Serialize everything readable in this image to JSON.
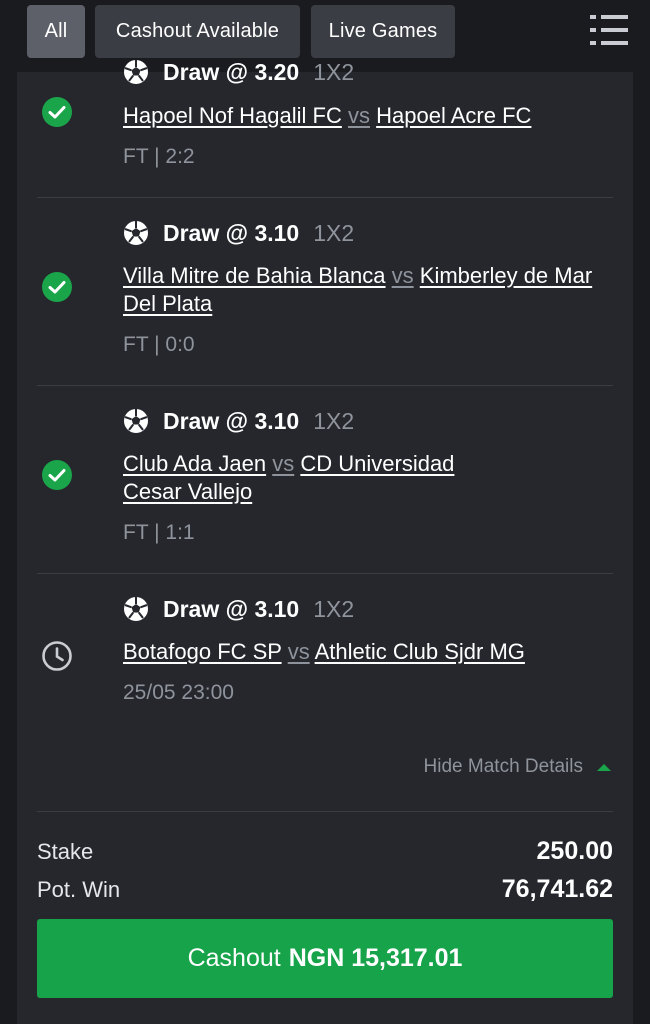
{
  "filters": [
    {
      "label": "All",
      "active": true
    },
    {
      "label": "Cashout Available",
      "active": false
    },
    {
      "label": "Live Games",
      "active": false
    }
  ],
  "legs": [
    {
      "pick": "Draw @ 3.20",
      "market": "1X2",
      "home": "Hapoel Nof Hagalil FC",
      "vs": "vs",
      "away": "Hapoel Acre FC",
      "meta": "FT | 2:2",
      "status": "won"
    },
    {
      "pick": "Draw @ 3.10",
      "market": "1X2",
      "home": "Villa Mitre de Bahia Blanca",
      "vs": "vs",
      "away": "Kimberley de Mar Del Plata",
      "meta": "FT | 0:0",
      "status": "won"
    },
    {
      "pick": "Draw @ 3.10",
      "market": "1X2",
      "home": "Club Ada Jaen",
      "vs": "vs",
      "away": "CD Universidad Cesar Vallejo",
      "meta": "FT | 1:1",
      "status": "won"
    },
    {
      "pick": "Draw @ 3.10",
      "market": "1X2",
      "home": "Botafogo FC SP",
      "vs": "vs",
      "away": "Athletic Club Sjdr MG",
      "meta": "25/05 23:00",
      "status": "pending"
    }
  ],
  "hide_details_label": "Hide Match Details",
  "summary": {
    "stake_label": "Stake",
    "stake_value": "250.00",
    "potwin_label": "Pot. Win",
    "potwin_value": "76,741.62"
  },
  "cashout": {
    "prefix": "Cashout",
    "amount": "NGN 15,317.01"
  },
  "colors": {
    "accent": "#16a34a",
    "background": "#1a1b1f",
    "card": "#25272d"
  }
}
